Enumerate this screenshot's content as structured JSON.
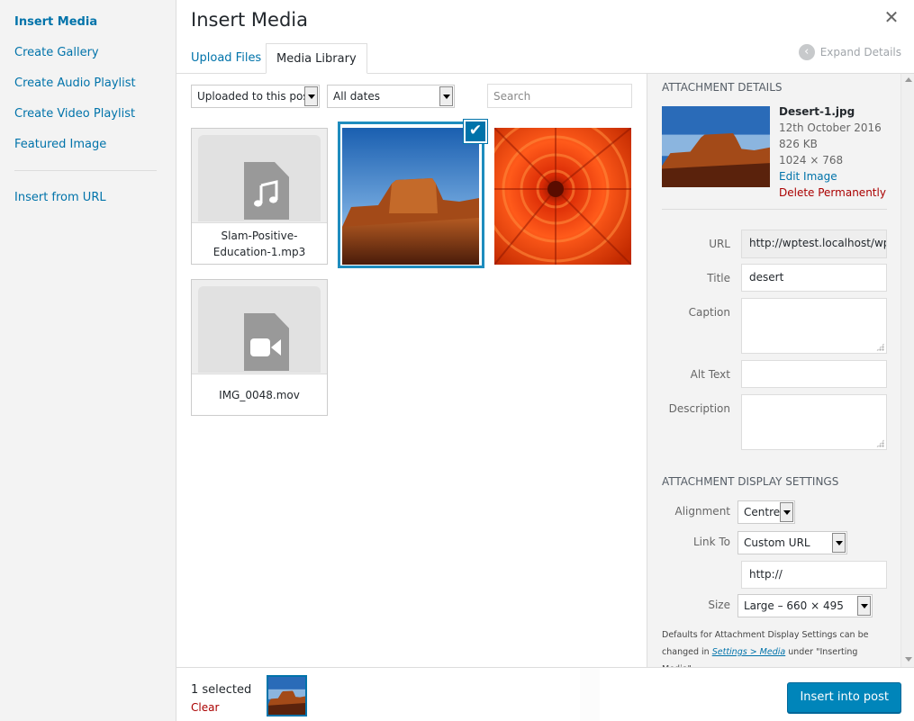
{
  "menu": {
    "insert_media": "Insert Media",
    "create_gallery": "Create Gallery",
    "create_audio_playlist": "Create Audio Playlist",
    "create_video_playlist": "Create Video Playlist",
    "featured_image": "Featured Image",
    "insert_from_url": "Insert from URL"
  },
  "header": {
    "title": "Insert Media",
    "close_icon": "close-icon",
    "tabs": [
      "Upload Files",
      "Media Library"
    ],
    "active_tab": "Media Library",
    "expand_details": "Expand Details"
  },
  "toolbar": {
    "filter_type": "Uploaded to this post",
    "filter_date": "All dates",
    "search_placeholder": "Search"
  },
  "attachments": [
    {
      "type": "audio",
      "filename": "Slam-Positive-Education-1.mp3"
    },
    {
      "type": "image",
      "filename": "",
      "selected": true
    },
    {
      "type": "image",
      "filename": ""
    },
    {
      "type": "video",
      "filename": "IMG_0048.mov"
    }
  ],
  "details": {
    "heading": "ATTACHMENT DETAILS",
    "filename": "Desert-1.jpg",
    "date": "12th October 2016",
    "size": "826 KB",
    "dimensions": "1024 × 768",
    "edit_image": "Edit Image",
    "delete": "Delete Permanently",
    "url_label": "URL",
    "url_value": "http://wptest.localhost/wp-",
    "title_label": "Title",
    "title_value": "desert",
    "caption_label": "Caption",
    "caption_value": "",
    "alt_label": "Alt Text",
    "alt_value": "",
    "description_label": "Description",
    "description_value": ""
  },
  "display": {
    "heading": "ATTACHMENT DISPLAY SETTINGS",
    "alignment_label": "Alignment",
    "alignment_value": "Centre",
    "link_label": "Link To",
    "link_value": "Custom URL",
    "link_url": "http://",
    "size_label": "Size",
    "size_value": "Large – 660 × 495",
    "note_prefix": "Defaults for Attachment Display Settings can be changed in",
    "note_link": "Settings > Media",
    "note_suffix": "under \"Inserting Media\"."
  },
  "footer": {
    "selected_count": "1 selected",
    "clear": "Clear",
    "insert_button": "Insert into post"
  },
  "colors": {
    "accent": "#0073aa",
    "button": "#0085ba",
    "danger": "#a00000"
  }
}
